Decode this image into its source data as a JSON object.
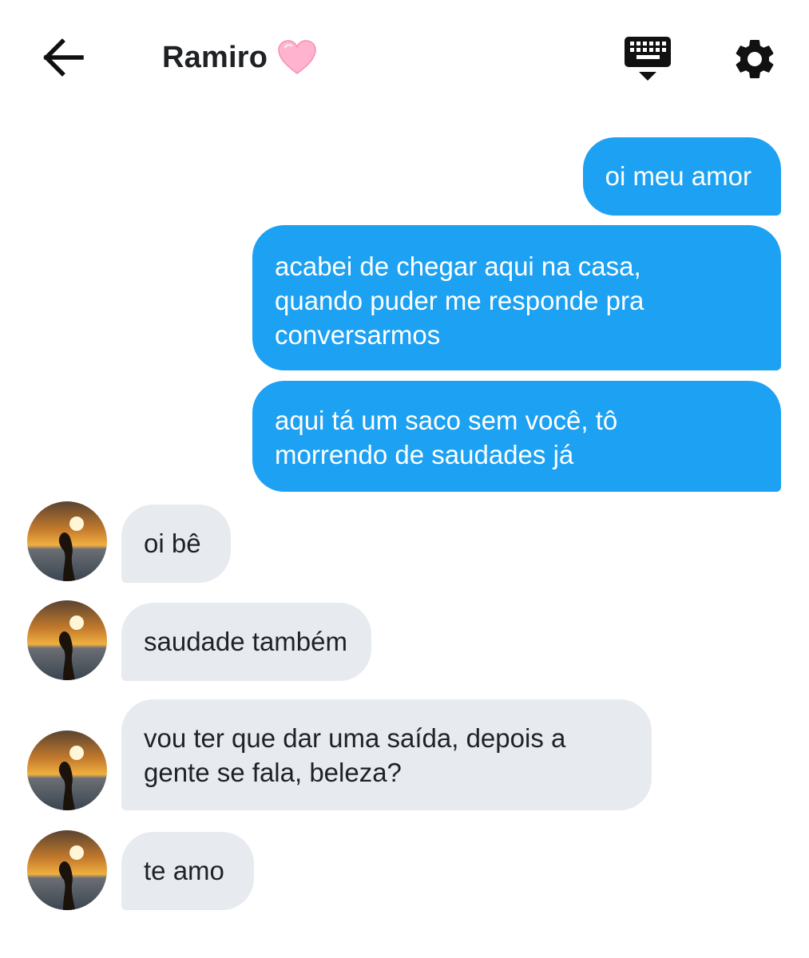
{
  "header": {
    "title": "Ramiro",
    "back_icon": "arrow-left-icon",
    "heart_icon": "pink-heart-emoji",
    "keyboard_icon": "keyboard-hide-icon",
    "settings_icon": "gear-icon"
  },
  "colors": {
    "outgoing_bubble": "#1da1f2",
    "incoming_bubble": "#e7ebef",
    "text_dark": "#1f2125"
  },
  "messages": [
    {
      "direction": "outgoing",
      "lines": [
        "oi meu amor"
      ]
    },
    {
      "direction": "outgoing",
      "lines": [
        "acabei de chegar aqui na casa,",
        "quando puder me responde pra",
        "conversarmos"
      ]
    },
    {
      "direction": "outgoing",
      "lines": [
        "aqui tá um saco sem você, tô",
        "morrendo de saudades já"
      ]
    },
    {
      "direction": "incoming",
      "lines": [
        "oi bê"
      ]
    },
    {
      "direction": "incoming",
      "lines": [
        "saudade também"
      ]
    },
    {
      "direction": "incoming",
      "lines": [
        "vou ter que dar uma saída, depois a",
        "gente se fala, beleza?"
      ]
    },
    {
      "direction": "incoming",
      "lines": [
        "te amo"
      ]
    }
  ]
}
